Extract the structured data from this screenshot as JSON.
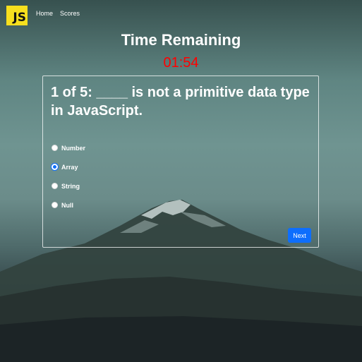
{
  "nav": {
    "logo": "JS",
    "links": [
      "Home",
      "Scores"
    ]
  },
  "timer": {
    "title": "Time Remaining",
    "value": "01:54",
    "color": "#ff0000"
  },
  "quiz": {
    "question": "1 of 5: ____ is not a primitive data type in JavaScript.",
    "answers": [
      "Number",
      "Array",
      "String",
      "Null"
    ],
    "selected": "Array",
    "next_label": "Next"
  },
  "colors": {
    "accent": "#0d6efd",
    "logo_bg": "#f7df1e"
  }
}
